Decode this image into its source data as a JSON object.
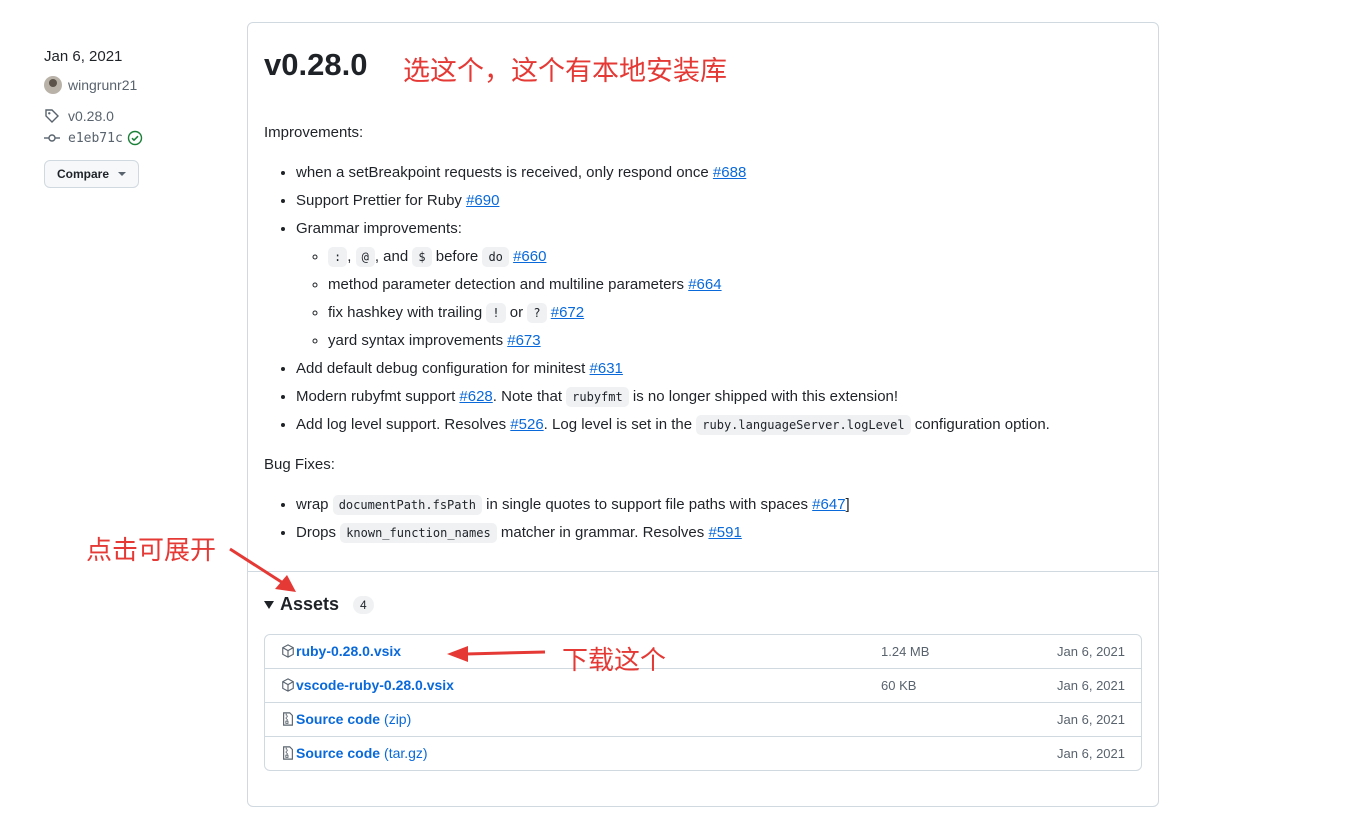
{
  "sidebar": {
    "date": "Jan 6, 2021",
    "author": "wingrunr21",
    "tag": "v0.28.0",
    "commit": "e1eb71c",
    "compare_label": "Compare"
  },
  "release": {
    "title": "v0.28.0",
    "improvements_heading": "Improvements:",
    "improvements": [
      {
        "pre": "when a setBreakpoint requests is received, only respond once ",
        "link": "#688"
      },
      {
        "pre": "Support Prettier for Ruby ",
        "link": "#690"
      },
      {
        "pre": "Grammar improvements:"
      },
      {
        "pre": "Add default debug configuration for minitest ",
        "link": "#631"
      },
      {
        "pre": "Modern rubyfmt support ",
        "link": "#628",
        "mid": ". Note that ",
        "code": "rubyfmt",
        "post": " is no longer shipped with this extension!"
      },
      {
        "pre": "Add log level support. Resolves ",
        "link": "#526",
        "mid": ". Log level is set in the ",
        "code": "ruby.languageServer.logLevel",
        "post": " configuration option."
      }
    ],
    "grammar_sub": [
      {
        "codes": [
          ":",
          "@",
          "$",
          "do"
        ],
        "seps": [
          ", ",
          ", and ",
          " before ",
          " "
        ],
        "link": "#660"
      },
      {
        "pre": "method parameter detection and multiline parameters ",
        "link": "#664"
      },
      {
        "pre": "fix hashkey with trailing ",
        "code1": "!",
        "mid": " or ",
        "code2": "?",
        "link": "#672"
      },
      {
        "pre": "yard syntax improvements ",
        "link": "#673"
      }
    ],
    "bugfix_heading": "Bug Fixes:",
    "bugfixes": [
      {
        "pre": "wrap ",
        "code": "documentPath.fsPath",
        "mid": " in single quotes to support file paths with spaces ",
        "link": "#647",
        "post": "]"
      },
      {
        "pre": "Drops ",
        "code": "known_function_names",
        "mid": " matcher in grammar. Resolves ",
        "link": "#591"
      }
    ]
  },
  "assets": {
    "heading": "Assets",
    "count": "4",
    "items": [
      {
        "name": "ruby-0.28.0.vsix",
        "ext": "",
        "size": "1.24 MB",
        "date": "Jan 6, 2021",
        "icon": "package-icon"
      },
      {
        "name": "vscode-ruby-0.28.0.vsix",
        "ext": "",
        "size": "60 KB",
        "date": "Jan 6, 2021",
        "icon": "package-icon"
      },
      {
        "name": "Source code",
        "ext": "(zip)",
        "size": "",
        "date": "Jan 6, 2021",
        "icon": "file-zip-icon"
      },
      {
        "name": "Source code",
        "ext": "(tar.gz)",
        "size": "",
        "date": "Jan 6, 2021",
        "icon": "file-zip-icon"
      }
    ]
  },
  "annotations": {
    "top": "选这个，这个有本地安装库",
    "expand": "点击可展开",
    "download": "下载这个",
    "color": "#e53935"
  }
}
